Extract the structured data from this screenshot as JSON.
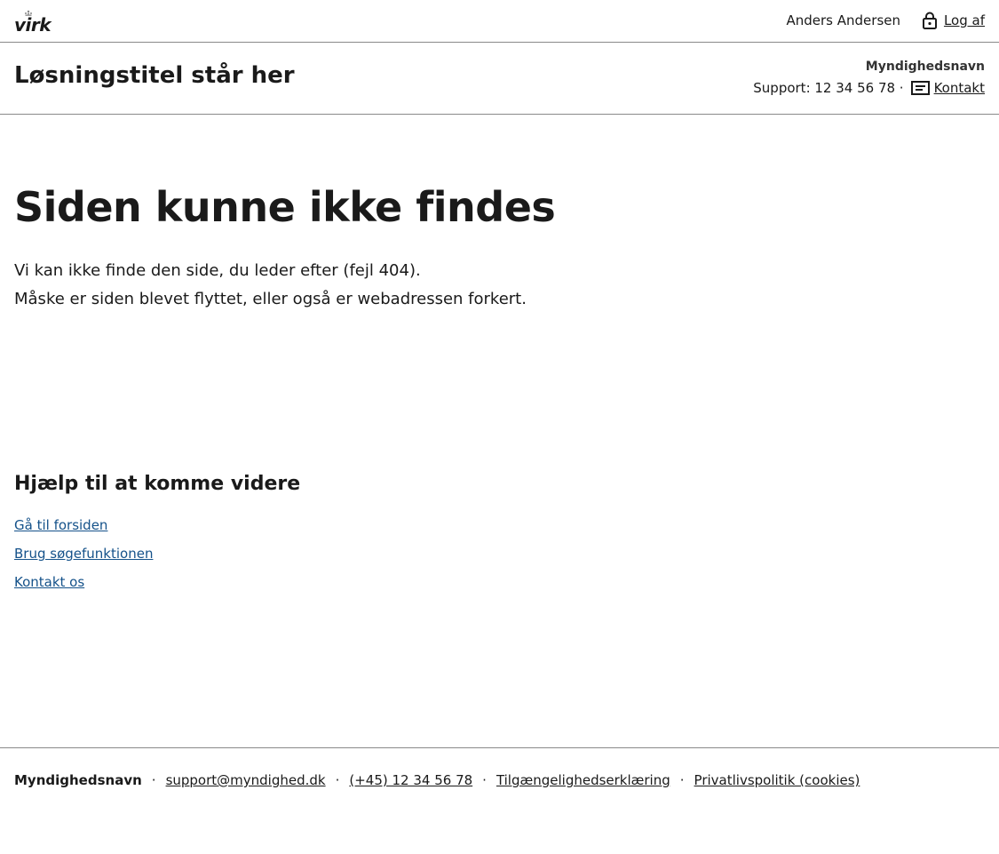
{
  "topbar": {
    "logo_text": "virk",
    "user_name": "Anders Andersen",
    "logout_label": "Log af"
  },
  "header": {
    "solution_title": "Løsningstitel står her",
    "authority": "Myndighedsnavn",
    "support_text": "Support: 12 34 56 78 ·",
    "contact_label": "Kontakt"
  },
  "main": {
    "heading": "Siden kunne ikke findes",
    "line1": "Vi kan ikke finde den side, du leder efter (fejl 404).",
    "line2": "Måske er siden blevet flyttet, eller også er webadressen forkert."
  },
  "help": {
    "heading": "Hjælp til at komme videre",
    "links": [
      "Gå til forsiden",
      "Brug søgefunktionen",
      "Kontakt os"
    ]
  },
  "footer": {
    "authority": "Myndighedsnavn",
    "separator": "·",
    "email": "support@myndighed.dk",
    "phone": "(+45) 12 34 56 78",
    "accessibility": "Tilgængelighedserklæring",
    "privacy": "Privatlivspolitik (cookies)"
  },
  "icons": {
    "logout": "lock-icon",
    "contact": "message-icon",
    "logo_crown": "crown-icon"
  },
  "colors": {
    "link": "#15528a",
    "text": "#1a1a1a",
    "divider": "#8a8a8a"
  }
}
